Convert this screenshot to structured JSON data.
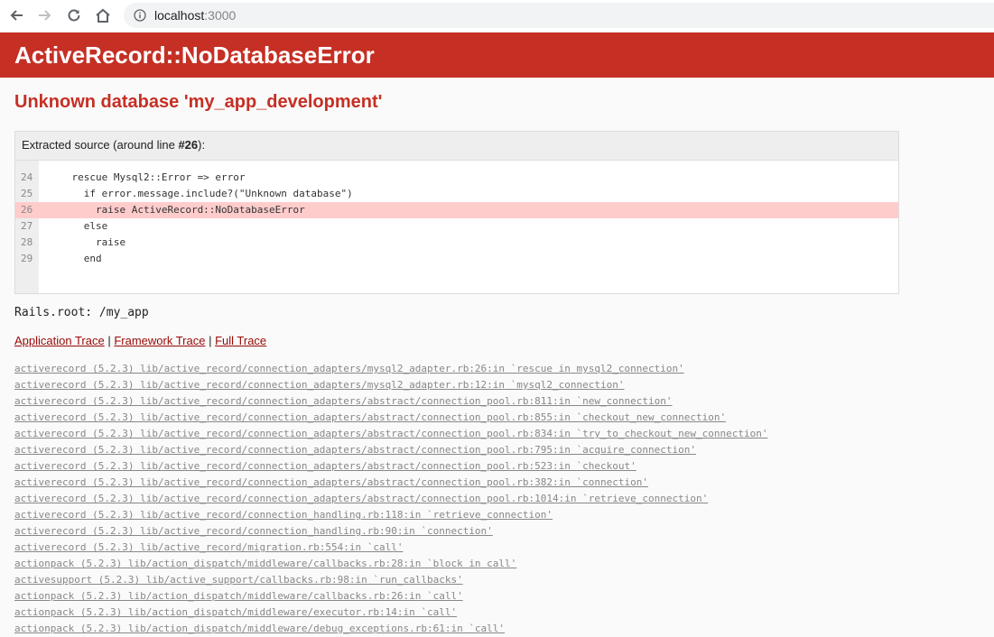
{
  "browser": {
    "url_host": "localhost",
    "url_port": ":3000"
  },
  "error": {
    "title": "ActiveRecord::NoDatabaseError",
    "message": "Unknown database 'my_app_development'"
  },
  "source": {
    "header_prefix": "Extracted source (around line ",
    "header_line": "#26",
    "header_suffix": "):",
    "lines": [
      {
        "num": "24",
        "code": "    rescue Mysql2::Error => error",
        "highlight": false
      },
      {
        "num": "25",
        "code": "      if error.message.include?(\"Unknown database\")",
        "highlight": false
      },
      {
        "num": "26",
        "code": "        raise ActiveRecord::NoDatabaseError",
        "highlight": true
      },
      {
        "num": "27",
        "code": "      else",
        "highlight": false
      },
      {
        "num": "28",
        "code": "        raise",
        "highlight": false
      },
      {
        "num": "29",
        "code": "      end",
        "highlight": false
      }
    ]
  },
  "rails_root": "Rails.root: /my_app",
  "trace_links": {
    "application": "Application Trace",
    "sep1": " | ",
    "framework": "Framework Trace",
    "sep2": " | ",
    "full": "Full Trace"
  },
  "trace": [
    "activerecord (5.2.3) lib/active_record/connection_adapters/mysql2_adapter.rb:26:in `rescue in mysql2_connection'",
    "activerecord (5.2.3) lib/active_record/connection_adapters/mysql2_adapter.rb:12:in `mysql2_connection'",
    "activerecord (5.2.3) lib/active_record/connection_adapters/abstract/connection_pool.rb:811:in `new_connection'",
    "activerecord (5.2.3) lib/active_record/connection_adapters/abstract/connection_pool.rb:855:in `checkout_new_connection'",
    "activerecord (5.2.3) lib/active_record/connection_adapters/abstract/connection_pool.rb:834:in `try_to_checkout_new_connection'",
    "activerecord (5.2.3) lib/active_record/connection_adapters/abstract/connection_pool.rb:795:in `acquire_connection'",
    "activerecord (5.2.3) lib/active_record/connection_adapters/abstract/connection_pool.rb:523:in `checkout'",
    "activerecord (5.2.3) lib/active_record/connection_adapters/abstract/connection_pool.rb:382:in `connection'",
    "activerecord (5.2.3) lib/active_record/connection_adapters/abstract/connection_pool.rb:1014:in `retrieve_connection'",
    "activerecord (5.2.3) lib/active_record/connection_handling.rb:118:in `retrieve_connection'",
    "activerecord (5.2.3) lib/active_record/connection_handling.rb:90:in `connection'",
    "activerecord (5.2.3) lib/active_record/migration.rb:554:in `call'",
    "actionpack (5.2.3) lib/action_dispatch/middleware/callbacks.rb:28:in `block in call'",
    "activesupport (5.2.3) lib/active_support/callbacks.rb:98:in `run_callbacks'",
    "actionpack (5.2.3) lib/action_dispatch/middleware/callbacks.rb:26:in `call'",
    "actionpack (5.2.3) lib/action_dispatch/middleware/executor.rb:14:in `call'",
    "actionpack (5.2.3) lib/action_dispatch/middleware/debug_exceptions.rb:61:in `call'"
  ]
}
